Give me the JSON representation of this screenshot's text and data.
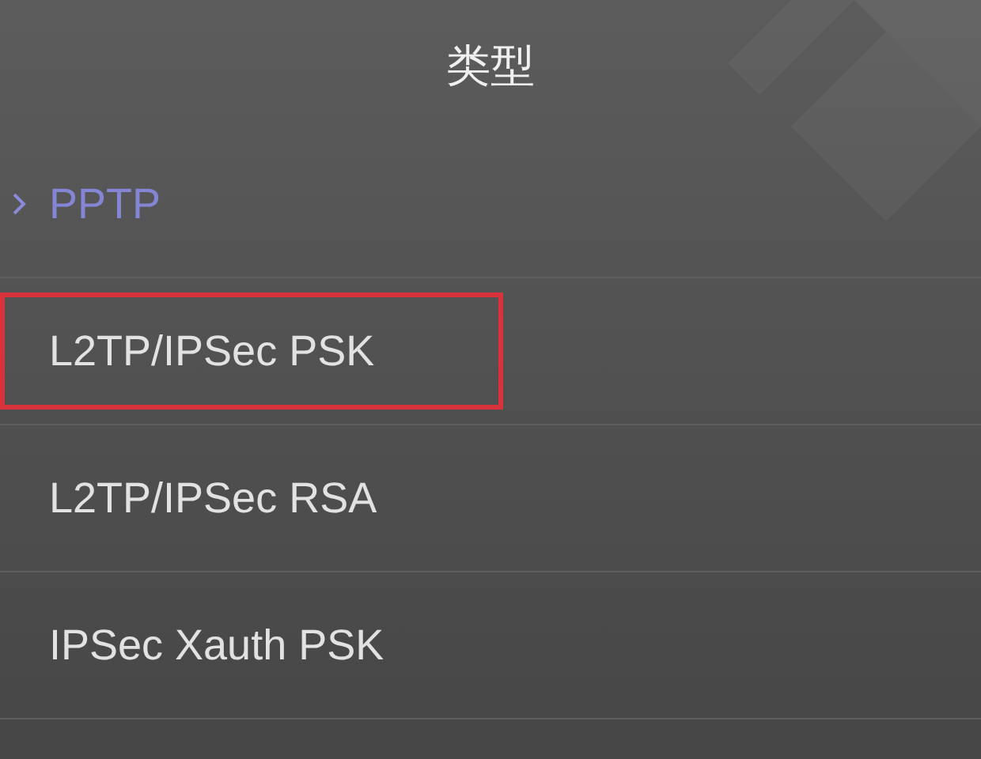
{
  "header": {
    "title": "类型"
  },
  "options": [
    {
      "label": "PPTP",
      "selected": true,
      "highlighted": false
    },
    {
      "label": "L2TP/IPSec PSK",
      "selected": false,
      "highlighted": true
    },
    {
      "label": "L2TP/IPSec RSA",
      "selected": false,
      "highlighted": false
    },
    {
      "label": "IPSec Xauth PSK",
      "selected": false,
      "highlighted": false
    }
  ]
}
